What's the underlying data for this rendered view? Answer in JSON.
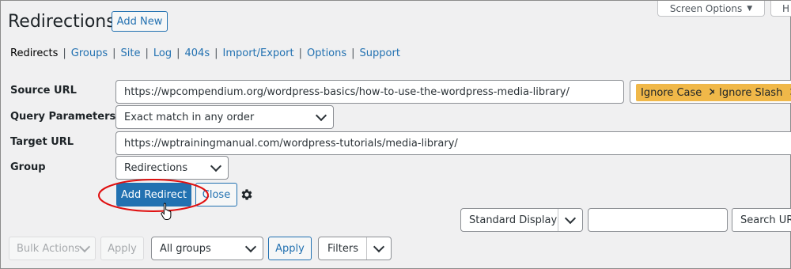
{
  "screen_options": {
    "label": "Screen Options",
    "arrow": "▼",
    "help_partial": "H"
  },
  "page": {
    "title": "Redirections",
    "add_new": "Add New"
  },
  "subnav": [
    {
      "label": "Redirects",
      "current": true
    },
    {
      "label": "Groups"
    },
    {
      "label": "Site"
    },
    {
      "label": "Log"
    },
    {
      "label": "404s"
    },
    {
      "label": "Import/Export"
    },
    {
      "label": "Options"
    },
    {
      "label": "Support"
    }
  ],
  "form": {
    "source_url": {
      "label": "Source URL",
      "value": "https://wpcompendium.org/wordpress-basics/how-to-use-the-wordpress-media-library/"
    },
    "flags": [
      {
        "label": "Ignore Case",
        "remove": "✕"
      },
      {
        "label": "Ignore Slash",
        "remove": "✕"
      }
    ],
    "query_parameters": {
      "label": "Query Parameters",
      "value": "Exact match in any order"
    },
    "target_url": {
      "label": "Target URL",
      "value": "https://wptrainingmanual.com/wordpress-tutorials/media-library/"
    },
    "group": {
      "label": "Group",
      "value": "Redirections"
    },
    "add_redirect": "Add Redirect",
    "close": "Close",
    "settings_icon": "gear-icon"
  },
  "table_nav": {
    "display": "Standard Display",
    "search_value": "",
    "search_button": "Search URL",
    "bulk_actions": "Bulk Actions",
    "apply_1": "Apply",
    "group_filter": "All groups",
    "apply_2": "Apply",
    "filters": "Filters"
  },
  "colors": {
    "accent": "#2271b1",
    "flag": "#f0b849",
    "annotation": "#e01010"
  }
}
